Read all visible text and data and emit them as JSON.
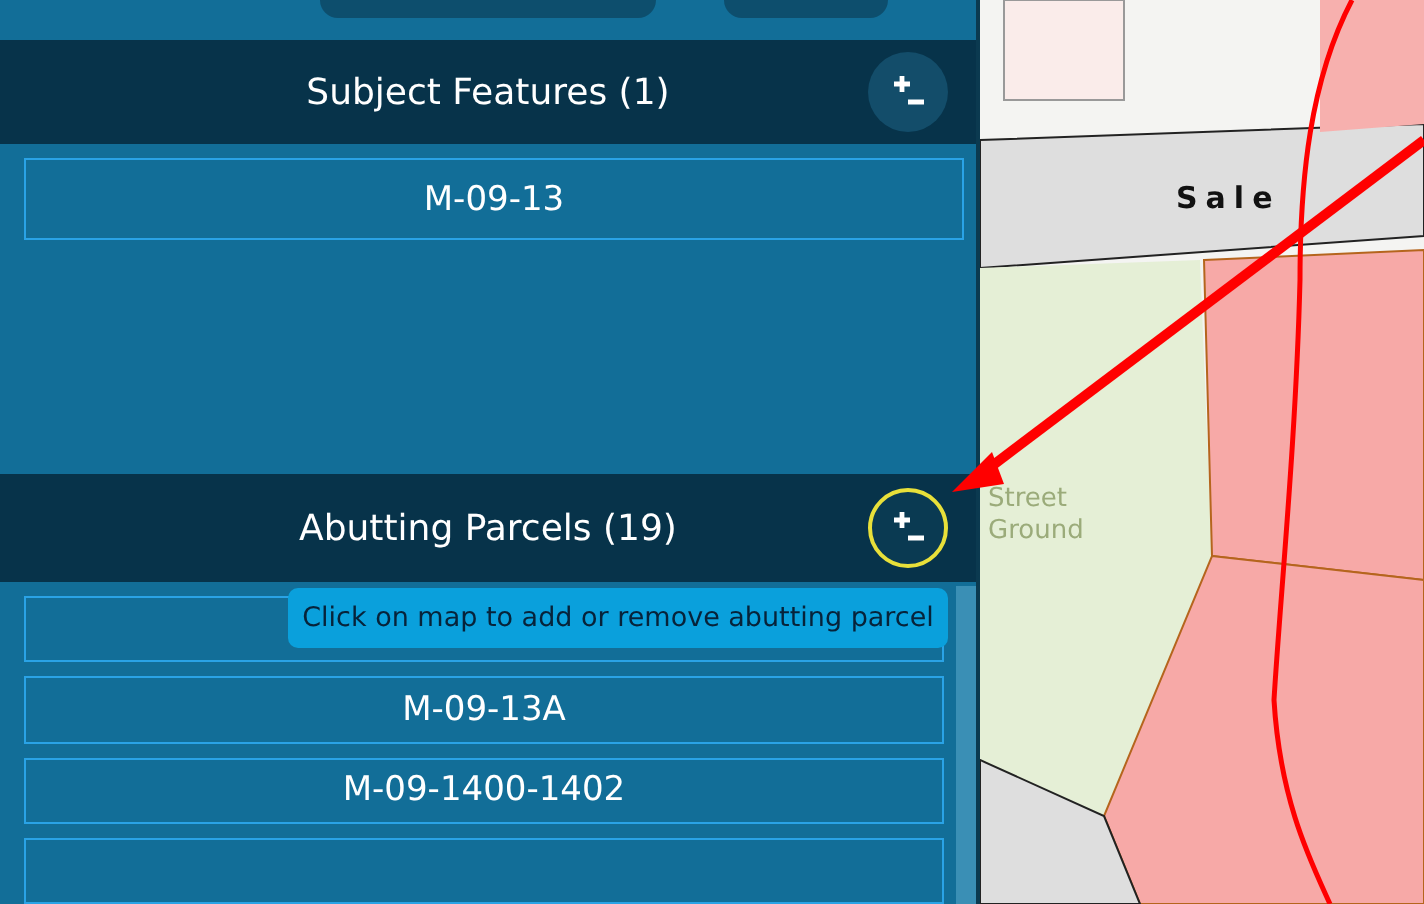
{
  "subject_features": {
    "title": "Subject Features (1)",
    "add_remove_button": {
      "highlighted": false
    },
    "items": [
      {
        "label": "M-09-13"
      }
    ]
  },
  "abutting_parcels": {
    "title": "Abutting Parcels (19)",
    "add_remove_button": {
      "highlighted": true
    },
    "tooltip": "Click on map to add or remove abutting parcel",
    "items": [
      {
        "kind": "covered"
      },
      {
        "kind": "labeled",
        "label": "M-09-13A"
      },
      {
        "kind": "labeled",
        "label": "M-09-1400-1402"
      },
      {
        "kind": "cut"
      }
    ]
  },
  "map": {
    "labels": [
      {
        "kind": "street",
        "text": "Sale"
      },
      {
        "kind": "area",
        "text": "Street"
      },
      {
        "kind": "area",
        "text": "Ground"
      }
    ]
  }
}
